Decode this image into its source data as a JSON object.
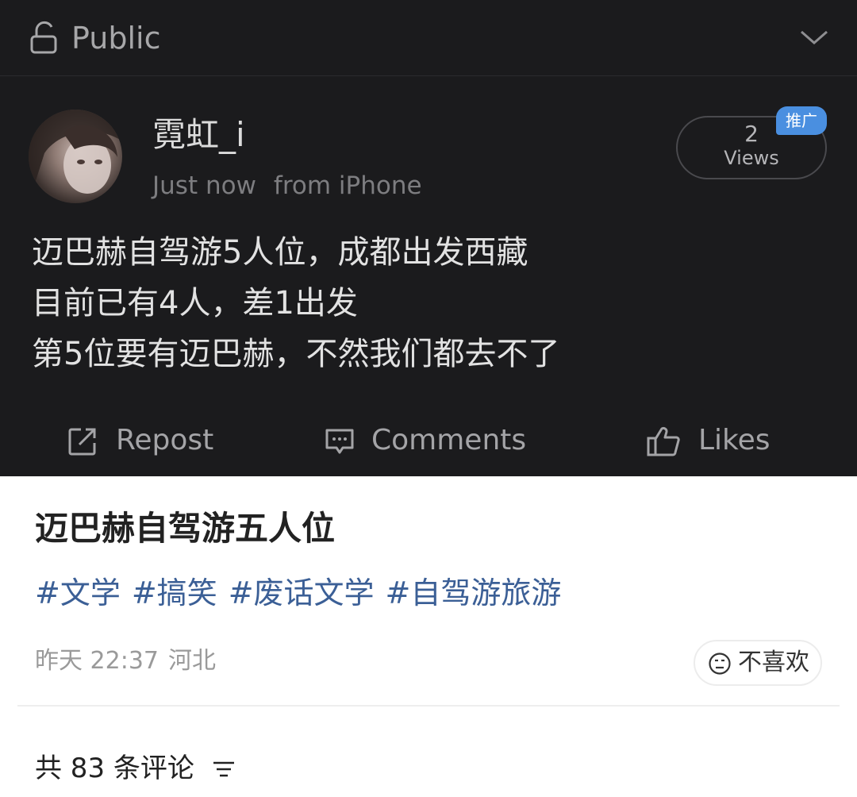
{
  "header": {
    "visibility_label": "Public",
    "lock_icon": "lock-open-icon",
    "expand_icon": "chevron-down-icon"
  },
  "post": {
    "author": "霓虹_i",
    "time": "Just now",
    "source": "from iPhone",
    "views": {
      "count": "2",
      "label": "Views",
      "badge": "推广"
    },
    "lines": [
      "迈巴赫自驾游5人位，成都出发西藏",
      "目前已有4人，差1出发",
      "第5位要有迈巴赫，不然我们都去不了"
    ],
    "actions": {
      "repost": "Repost",
      "comments": "Comments",
      "likes": "Likes"
    }
  },
  "note": {
    "title": "迈巴赫自驾游五人位",
    "tags": [
      "#文学",
      "#搞笑",
      "#废话文学",
      "#自驾游旅游"
    ],
    "date": "昨天 22:37",
    "location": "河北",
    "dislike_label": "不喜欢",
    "comments_summary": "共 83 条评论"
  },
  "colors": {
    "dark_bg": "#1b1b1d",
    "tag_blue": "#3b5f96",
    "badge_blue": "#4a8fe0"
  }
}
